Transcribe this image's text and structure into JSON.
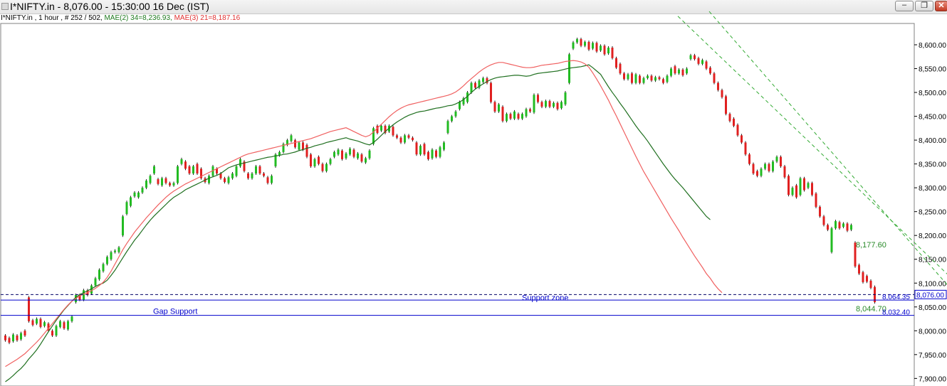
{
  "window": {
    "title": "I*NIFTY.in - 8,076.00 - 15:30:00  16 Dec (IST)",
    "minimize_glyph": "–",
    "maximize_glyph": "❐",
    "close_glyph": "✕"
  },
  "info_line": {
    "symbol_text": "I*NIFTY.in , 1 hour , # 252 / 502,",
    "ma2_text": "MAE(2) 34=8,236.93,",
    "ma3_text": "MAE(3) 21=8,187.16"
  },
  "colors": {
    "up": "#22bb22",
    "down": "#e02020",
    "ma34": "#1f6f1f",
    "ma21": "#f06060",
    "channel": "#33aa33",
    "support": "#0000cc",
    "axis_text": "#000000"
  },
  "chart_data": {
    "type": "candlestick",
    "symbol": "I*NIFTY.in",
    "timeframe": "1 hour",
    "ylim": [
      7900,
      8650
    ],
    "y_ticks": [
      "7,900.00",
      "7,950.00",
      "8,000.00",
      "8,050.00",
      "8,100.00",
      "8,150.00",
      "8,200.00",
      "8,250.00",
      "8,300.00",
      "8,350.00",
      "8,400.00",
      "8,450.00",
      "8,500.00",
      "8,550.00",
      "8,600.00"
    ],
    "last_price_label": "8,076.00",
    "candles": [
      [
        7990,
        7980
      ],
      [
        7985,
        7975
      ],
      [
        7978,
        7992
      ],
      [
        7990,
        7980
      ],
      [
        7982,
        7995
      ],
      [
        8000,
        7990
      ],
      [
        8070,
        8020
      ],
      [
        8022,
        8012
      ],
      [
        8015,
        8025
      ],
      [
        8025,
        8008
      ],
      [
        8010,
        8018
      ],
      [
        8015,
        8000
      ],
      [
        8000,
        7990
      ],
      [
        7990,
        8010
      ],
      [
        8008,
        8020
      ],
      [
        8018,
        8005
      ],
      [
        8003,
        8020
      ],
      [
        8020,
        8030
      ],
      [
        8060,
        8075
      ],
      [
        8075,
        8065
      ],
      [
        8065,
        8085
      ],
      [
        8085,
        8075
      ],
      [
        8078,
        8095
      ],
      [
        8095,
        8110
      ],
      [
        8108,
        8128
      ],
      [
        8125,
        8140
      ],
      [
        8140,
        8155
      ],
      [
        8150,
        8165
      ],
      [
        8165,
        8168
      ],
      [
        8165,
        8175
      ],
      [
        8200,
        8240
      ],
      [
        8245,
        8270
      ],
      [
        8262,
        8280
      ],
      [
        8282,
        8290
      ],
      [
        8280,
        8290
      ],
      [
        8290,
        8300
      ],
      [
        8300,
        8315
      ],
      [
        8310,
        8325
      ],
      [
        8330,
        8345
      ],
      [
        8318,
        8308
      ],
      [
        8305,
        8320
      ],
      [
        8320,
        8310
      ],
      [
        8310,
        8305
      ],
      [
        8305,
        8310
      ],
      [
        8310,
        8345
      ],
      [
        8350,
        8360
      ],
      [
        8355,
        8340
      ],
      [
        8345,
        8330
      ],
      [
        8330,
        8345
      ],
      [
        8350,
        8330
      ],
      [
        8340,
        8320
      ],
      [
        8320,
        8312
      ],
      [
        8310,
        8325
      ],
      [
        8325,
        8345
      ],
      [
        8340,
        8330
      ],
      [
        8330,
        8320
      ],
      [
        8320,
        8312
      ],
      [
        8310,
        8322
      ],
      [
        8320,
        8330
      ],
      [
        8325,
        8345
      ],
      [
        8345,
        8360
      ],
      [
        8355,
        8335
      ],
      [
        8330,
        8320
      ],
      [
        8320,
        8330
      ],
      [
        8330,
        8345
      ],
      [
        8345,
        8330
      ],
      [
        8330,
        8325
      ],
      [
        8322,
        8310
      ],
      [
        8310,
        8325
      ],
      [
        8345,
        8370
      ],
      [
        8368,
        8375
      ],
      [
        8375,
        8392
      ],
      [
        8390,
        8400
      ],
      [
        8398,
        8410
      ],
      [
        8400,
        8385
      ],
      [
        8380,
        8395
      ],
      [
        8395,
        8380
      ],
      [
        8390,
        8365
      ],
      [
        8370,
        8345
      ],
      [
        8345,
        8360
      ],
      [
        8365,
        8350
      ],
      [
        8350,
        8335
      ],
      [
        8335,
        8350
      ],
      [
        8350,
        8360
      ],
      [
        8365,
        8375
      ],
      [
        8370,
        8380
      ],
      [
        8378,
        8360
      ],
      [
        8362,
        8372
      ],
      [
        8370,
        8382
      ],
      [
        8380,
        8365
      ],
      [
        8362,
        8372
      ],
      [
        8370,
        8355
      ],
      [
        8353,
        8362
      ],
      [
        8362,
        8378
      ],
      [
        8392,
        8425
      ],
      [
        8430,
        8415
      ],
      [
        8420,
        8430
      ],
      [
        8430,
        8415
      ],
      [
        8418,
        8430
      ],
      [
        8428,
        8410
      ],
      [
        8410,
        8405
      ],
      [
        8405,
        8395
      ],
      [
        8395,
        8410
      ],
      [
        8410,
        8405
      ],
      [
        8405,
        8400
      ],
      [
        8395,
        8370
      ],
      [
        8370,
        8388
      ],
      [
        8392,
        8370
      ],
      [
        8375,
        8360
      ],
      [
        8362,
        8380
      ],
      [
        8378,
        8365
      ],
      [
        8365,
        8385
      ],
      [
        8380,
        8395
      ],
      [
        8415,
        8440
      ],
      [
        8440,
        8450
      ],
      [
        8450,
        8460
      ],
      [
        8465,
        8480
      ],
      [
        8475,
        8488
      ],
      [
        8480,
        8500
      ],
      [
        8500,
        8520
      ],
      [
        8520,
        8510
      ],
      [
        8510,
        8525
      ],
      [
        8522,
        8530
      ],
      [
        8530,
        8520
      ],
      [
        8520,
        8480
      ],
      [
        8480,
        8460
      ],
      [
        8460,
        8475
      ],
      [
        8470,
        8440
      ],
      [
        8440,
        8455
      ],
      [
        8455,
        8445
      ],
      [
        8445,
        8460
      ],
      [
        8455,
        8445
      ],
      [
        8445,
        8455
      ],
      [
        8450,
        8465
      ],
      [
        8465,
        8460
      ],
      [
        8458,
        8495
      ],
      [
        8495,
        8480
      ],
      [
        8480,
        8470
      ],
      [
        8470,
        8482
      ],
      [
        8482,
        8470
      ],
      [
        8470,
        8478
      ],
      [
        8478,
        8465
      ],
      [
        8467,
        8480
      ],
      [
        8475,
        8500
      ],
      [
        8520,
        8580
      ],
      [
        8592,
        8605
      ],
      [
        8605,
        8612
      ],
      [
        8612,
        8598
      ],
      [
        8598,
        8606
      ],
      [
        8606,
        8590
      ],
      [
        8592,
        8604
      ],
      [
        8604,
        8586
      ],
      [
        8588,
        8598
      ],
      [
        8598,
        8580
      ],
      [
        8582,
        8594
      ],
      [
        8594,
        8572
      ],
      [
        8572,
        8552
      ],
      [
        8560,
        8540
      ],
      [
        8540,
        8528
      ],
      [
        8528,
        8538
      ],
      [
        8540,
        8520
      ],
      [
        8520,
        8538
      ],
      [
        8535,
        8520
      ],
      [
        8520,
        8530
      ],
      [
        8530,
        8535
      ],
      [
        8535,
        8525
      ],
      [
        8525,
        8532
      ],
      [
        8532,
        8528
      ],
      [
        8528,
        8520
      ],
      [
        8522,
        8535
      ],
      [
        8535,
        8550
      ],
      [
        8555,
        8540
      ],
      [
        8540,
        8548
      ],
      [
        8548,
        8536
      ],
      [
        8540,
        8550
      ],
      [
        8570,
        8578
      ],
      [
        8578,
        8570
      ],
      [
        8572,
        8560
      ],
      [
        8560,
        8568
      ],
      [
        8565,
        8550
      ],
      [
        8552,
        8540
      ],
      [
        8540,
        8520
      ],
      [
        8520,
        8505
      ],
      [
        8505,
        8490
      ],
      [
        8492,
        8455
      ],
      [
        8455,
        8440
      ],
      [
        8445,
        8430
      ],
      [
        8432,
        8410
      ],
      [
        8410,
        8395
      ],
      [
        8395,
        8370
      ],
      [
        8370,
        8350
      ],
      [
        8350,
        8330
      ],
      [
        8335,
        8325
      ],
      [
        8325,
        8340
      ],
      [
        8340,
        8350
      ],
      [
        8350,
        8335
      ],
      [
        8335,
        8355
      ],
      [
        8355,
        8365
      ],
      [
        8365,
        8345
      ],
      [
        8345,
        8322
      ],
      [
        8325,
        8285
      ],
      [
        8285,
        8300
      ],
      [
        8305,
        8280
      ],
      [
        8285,
        8320
      ],
      [
        8320,
        8295
      ],
      [
        8300,
        8310
      ],
      [
        8310,
        8285
      ],
      [
        8288,
        8260
      ],
      [
        8260,
        8240
      ],
      [
        8240,
        8222
      ],
      [
        8222,
        8212
      ],
      [
        8165,
        8215
      ],
      [
        8215,
        8230
      ],
      [
        8228,
        8215
      ],
      [
        8218,
        8225
      ],
      [
        8225,
        8210
      ],
      [
        8212,
        8222
      ],
      [
        8185,
        8135
      ],
      [
        8138,
        8120
      ],
      [
        8123,
        8102
      ],
      [
        8115,
        8103
      ],
      [
        8105,
        8090
      ],
      [
        8092,
        8060
      ]
    ],
    "series": [
      {
        "name": "MAE(2) 34",
        "values": [
          7893,
          7899,
          7906,
          7914,
          7921,
          7930,
          7941,
          7950,
          7960,
          7972,
          7985,
          7998,
          8010,
          8022,
          8033,
          8044,
          8053,
          8062,
          8070,
          8076,
          8080,
          8084,
          8088,
          8093,
          8097,
          8100,
          8106,
          8116,
          8127,
          8140,
          8153,
          8166,
          8178,
          8190,
          8200,
          8211,
          8222,
          8232,
          8241,
          8249,
          8257,
          8265,
          8273,
          8280,
          8285,
          8290,
          8296,
          8300,
          8304,
          8308,
          8312,
          8316,
          8320,
          8323,
          8326,
          8330,
          8336,
          8342,
          8345,
          8348,
          8350,
          8352,
          8354,
          8356,
          8358,
          8360,
          8362,
          8364,
          8365,
          8367,
          8368,
          8370,
          8371,
          8373,
          8375,
          8378,
          8380,
          8383,
          8385,
          8388,
          8390,
          8392,
          8395,
          8397,
          8399,
          8401,
          8403,
          8405,
          8402,
          8400,
          8398,
          8395,
          8392,
          8390,
          8395,
          8402,
          8410,
          8418,
          8425,
          8432,
          8438,
          8443,
          8448,
          8452,
          8455,
          8458,
          8460,
          8461,
          8463,
          8465,
          8467,
          8468,
          8470,
          8472,
          8473,
          8476,
          8480,
          8485,
          8492,
          8500,
          8507,
          8513,
          8518,
          8523,
          8527,
          8530,
          8532,
          8533,
          8534,
          8535,
          8536,
          8536,
          8535,
          8534,
          8535,
          8538,
          8540,
          8541,
          8542,
          8543,
          8544,
          8545,
          8547,
          8549,
          8551,
          8552,
          8553,
          8554,
          8556,
          8558,
          8552,
          8545,
          8538,
          8525,
          8512,
          8500,
          8489,
          8477,
          8466,
          8454,
          8442,
          8430,
          8419,
          8409,
          8398,
          8386,
          8374,
          8362,
          8350,
          8339,
          8328,
          8318,
          8309,
          8300,
          8290,
          8280,
          8270,
          8260,
          8250,
          8240,
          8233
        ]
      },
      {
        "name": "MAE(3) 21",
        "values": [
          7925,
          7930,
          7935,
          7940,
          7946,
          7952,
          7960,
          7968,
          7976,
          7985,
          7995,
          8005,
          8015,
          8025,
          8035,
          8045,
          8054,
          8062,
          8068,
          8073,
          8077,
          8080,
          8084,
          8089,
          8095,
          8102,
          8112,
          8125,
          8140,
          8155,
          8170,
          8183,
          8195,
          8207,
          8217,
          8227,
          8237,
          8246,
          8255,
          8264,
          8272,
          8280,
          8287,
          8293,
          8298,
          8303,
          8308,
          8312,
          8316,
          8320,
          8324,
          8328,
          8332,
          8336,
          8340,
          8344,
          8348,
          8352,
          8356,
          8360,
          8364,
          8368,
          8371,
          8373,
          8375,
          8377,
          8379,
          8381,
          8383,
          8385,
          8387,
          8389,
          8391,
          8393,
          8395,
          8397,
          8399,
          8401,
          8403,
          8406,
          8409,
          8412,
          8415,
          8418,
          8420,
          8422,
          8424,
          8426,
          8422,
          8418,
          8414,
          8410,
          8407,
          8410,
          8417,
          8425,
          8433,
          8441,
          8449,
          8456,
          8462,
          8467,
          8471,
          8474,
          8476,
          8478,
          8480,
          8482,
          8484,
          8486,
          8488,
          8490,
          8492,
          8494,
          8497,
          8501,
          8507,
          8514,
          8522,
          8529,
          8536,
          8543,
          8549,
          8554,
          8558,
          8561,
          8563,
          8563,
          8561,
          8559,
          8557,
          8555,
          8553,
          8552,
          8552,
          8553,
          8555,
          8557,
          8558,
          8559,
          8560,
          8561,
          8563,
          8565,
          8566,
          8567,
          8566,
          8564,
          8560,
          8553,
          8541,
          8528,
          8514,
          8499,
          8484,
          8467,
          8451,
          8434,
          8417,
          8400,
          8383,
          8366,
          8350,
          8334,
          8320,
          8306,
          8292,
          8278,
          8264,
          8250,
          8236,
          8223,
          8210,
          8196,
          8183,
          8170,
          8157,
          8145,
          8133,
          8120,
          8110,
          8098,
          8088,
          8080
        ]
      }
    ],
    "horizontal_lines": [
      {
        "label": "Support zone",
        "value": 8076.0,
        "style": "dashed",
        "price_label": "8,064.35"
      },
      {
        "label": "",
        "value": 8064.35,
        "style": "solid"
      },
      {
        "label": "Gap Support",
        "value": 8032.4,
        "style": "solid",
        "price_label": "8,032.40"
      }
    ],
    "channel": [
      {
        "from": [
          172,
          8660
        ],
        "to": [
          268,
          7905
        ],
        "label": "8,044.70"
      },
      {
        "from": [
          180,
          8670
        ],
        "to": [
          251,
          8000
        ],
        "label": "8,177.60"
      }
    ]
  }
}
